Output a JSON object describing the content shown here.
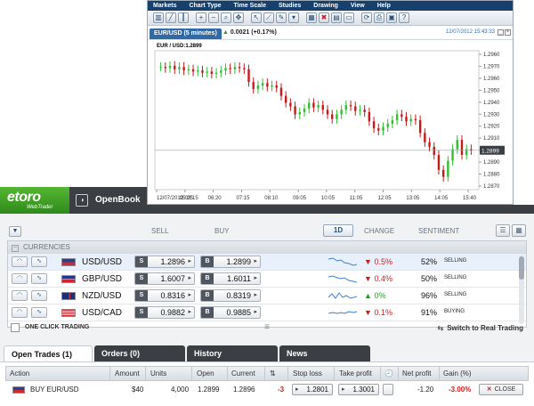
{
  "chart_window": {
    "menu": [
      "Markets",
      "Chart Type",
      "Time Scale",
      "Studies",
      "Drawing",
      "View",
      "Help"
    ],
    "symbol_tab": "EUR/USD (5 minutes)",
    "change_arrow": "▲",
    "change": "0.0021 (+0.17%)",
    "timestamp": "12/07/2012 15:43:33",
    "legend": "EUR / USD:1.2899",
    "min_button": "_",
    "close_button": "×"
  },
  "chart_data": {
    "type": "line",
    "title": "EUR / USD:1.2899",
    "x_ticks": [
      "12/07/2012 03:15",
      "05:25",
      "06:20",
      "07:15",
      "08:10",
      "09:05",
      "10:05",
      "11:05",
      "12:05",
      "13:05",
      "14:05",
      "15:40"
    ],
    "ylim": [
      1.2865,
      1.2985
    ],
    "y_ticks": [
      "1.2960",
      "1.2970",
      "1.2960",
      "1.2950",
      "1.2940",
      "1.2930",
      "1.2920",
      "1.2910",
      "1.2900",
      "1.2890",
      "1.2880",
      "1.2870"
    ],
    "last_price": "1.2899",
    "series": [
      {
        "values": [
          1.2971,
          1.297,
          1.2972,
          1.2969,
          1.2971,
          1.2968,
          1.2969,
          1.2967,
          1.2968,
          1.2966,
          1.2967,
          1.2965,
          1.2966,
          1.2968,
          1.297,
          1.2969,
          1.2971,
          1.297,
          1.2969,
          1.2958,
          1.2952,
          1.2955,
          1.2957,
          1.2954,
          1.2955,
          1.2953,
          1.2946,
          1.294,
          1.2937,
          1.293,
          1.2932,
          1.2935,
          1.294,
          1.2936,
          1.2938,
          1.2934,
          1.293,
          1.2926,
          1.293,
          1.2934,
          1.2938,
          1.2937,
          1.2933,
          1.2934,
          1.2932,
          1.2924,
          1.2918,
          1.2916,
          1.2919,
          1.2922,
          1.2925,
          1.293,
          1.2928,
          1.2924,
          1.2926,
          1.2925,
          1.2914,
          1.2906,
          1.2902,
          1.2895,
          1.2882,
          1.2876,
          1.289,
          1.29,
          1.2908,
          1.2895,
          1.29,
          1.2899
        ]
      }
    ]
  },
  "logo": {
    "brand": "etoro",
    "sub": "WebTrader",
    "openbook_icon": "openbook-icon",
    "openbook": "OpenBook"
  },
  "columns": {
    "filter_icon": "funnel-icon",
    "sell": "SELL",
    "buy": "BUY",
    "timeframe": "1D",
    "change": "CHANGE",
    "sentiment": "SENTIMENT",
    "list_view": "☰",
    "grid_view": "▦"
  },
  "currencies": {
    "header": "CURRENCIES",
    "rows": [
      {
        "pair": "USD/USD",
        "sell": "1.2896",
        "buy": "1.2899",
        "arrow": "▼",
        "change": "0.5%",
        "dir": "down",
        "pct": "52%",
        "sentiment": "SELLING",
        "flag": "eu"
      },
      {
        "pair": "GBP/USD",
        "sell": "1.6007",
        "buy": "1.6011",
        "arrow": "▼",
        "change": "0.4%",
        "dir": "down",
        "pct": "50%",
        "sentiment": "SELLING",
        "flag": "gb"
      },
      {
        "pair": "NZD/USD",
        "sell": "0.8316",
        "buy": "0.8319",
        "arrow": "▲",
        "change": "0%",
        "dir": "up",
        "pct": "96%",
        "sentiment": "SELLING",
        "flag": "nz"
      },
      {
        "pair": "USD/CAD",
        "sell": "0.9882",
        "buy": "0.9885",
        "arrow": "▼",
        "change": "0.1%",
        "dir": "down",
        "pct": "91%",
        "sentiment": "BUYING",
        "flag": "us"
      }
    ]
  },
  "one_click": "ONE CLICK TRADING",
  "switch_real": "Switch to Real Trading",
  "tabs": [
    "Open Trades (1)",
    "Orders (0)",
    "History",
    "News"
  ],
  "trades": {
    "headers": [
      "Action",
      "Amount",
      "Units",
      "Open",
      "Current",
      "⇅",
      "Stop loss",
      "Take profit",
      "🕘",
      "Net profit",
      "Gain (%)"
    ],
    "rows": [
      {
        "action": "BUY EUR/USD",
        "amount": "$40",
        "units": "4,000",
        "open": "1.2899",
        "current": "1.2896",
        "pips": "-3",
        "stop_loss": "1.2801",
        "take_profit": "1.3001",
        "net_profit": "-1.20",
        "gain": "-3.00%",
        "close_label": "CLOSE"
      }
    ]
  },
  "colors": {
    "brand_green": "#3ea11f",
    "dark_bar": "#3b3f44",
    "chart_up": "#2ec22e",
    "chart_down": "#c81818"
  }
}
